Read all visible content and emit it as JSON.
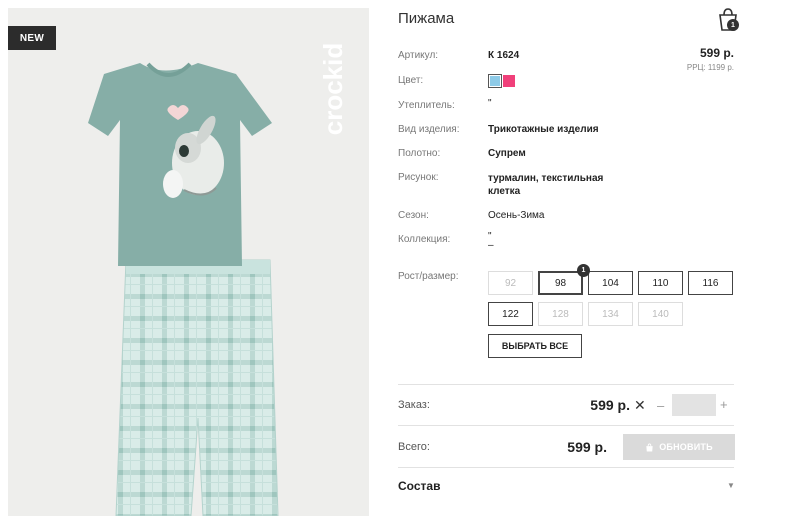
{
  "badge": "NEW",
  "brand": "crockid",
  "title": "Пижама",
  "cart": {
    "count": "1"
  },
  "details": [
    {
      "label": "Артикул:",
      "value": "К 1624"
    },
    {
      "label": "Цвет:",
      "value": ""
    },
    {
      "label": "Утеплитель:",
      "value": "\""
    },
    {
      "label": "Вид изделия:",
      "value": "Трикотажные изделия"
    },
    {
      "label": "Полотно:",
      "value": "Супрем"
    },
    {
      "label": "Рисунок:",
      "value": "турмалин, текстильная клетка"
    },
    {
      "label": "Сезон:",
      "value": "Осень-Зима"
    },
    {
      "label": "Коллекция:",
      "value": "\"\n–"
    }
  ],
  "price": "599 р.",
  "rrp": "РРЦ: 1199 р.",
  "colors": [
    "#8ecbe8",
    "#f0407a"
  ],
  "sizes_label": "Рост/размер:",
  "sizes": [
    {
      "label": "92",
      "state": "disabled"
    },
    {
      "label": "98",
      "state": "selected"
    },
    {
      "label": "104",
      "state": "available"
    },
    {
      "label": "110",
      "state": "available"
    },
    {
      "label": "116",
      "state": "available"
    },
    {
      "label": "122",
      "state": "available"
    },
    {
      "label": "128",
      "state": "disabled"
    },
    {
      "label": "134",
      "state": "disabled"
    },
    {
      "label": "140",
      "state": "disabled"
    }
  ],
  "selected_size_count": "1",
  "select_all": "ВЫБРАТЬ ВСЕ",
  "order": {
    "label": "Заказ:",
    "price": "599 р.",
    "remove": "✕",
    "minus": "–",
    "plus": "+",
    "qty": ""
  },
  "total": {
    "label": "Всего:",
    "price": "599 р.",
    "button": "ОБНОВИТЬ"
  },
  "composition": "Состав"
}
